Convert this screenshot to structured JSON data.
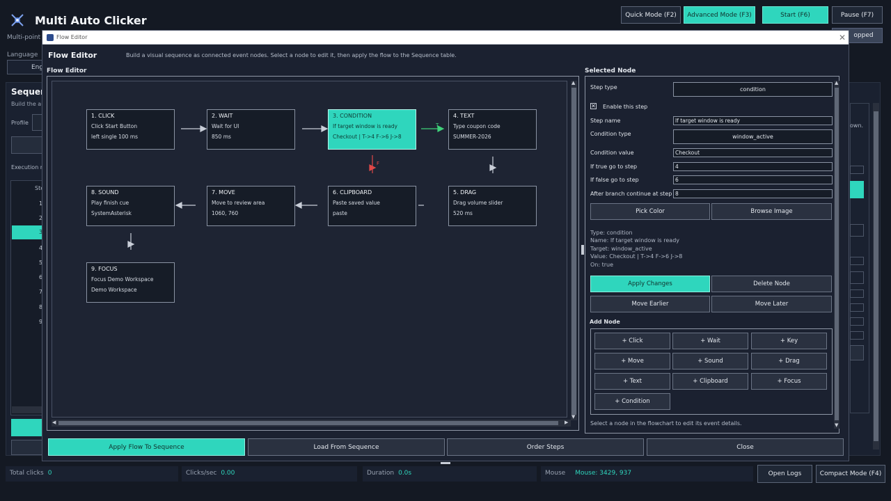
{
  "app": {
    "title": "Multi Auto Clicker",
    "subtitle": "Multi-point a",
    "language_label": "Language",
    "language_value": "Eng",
    "sequence_title": "Sequen",
    "sequence_subtitle": "Build the au",
    "profile_label": "Profile",
    "execution_label": "Execution m",
    "table_header": "Ste",
    "row_numbers": [
      "1",
      "2",
      "3",
      "4",
      "5",
      "6",
      "7",
      "8",
      "9"
    ],
    "stopped_label": "opped",
    "hint_fragment": "own.",
    "accent_color": "#2fd6bd"
  },
  "top_buttons": {
    "quick_mode": "Quick Mode (F2)",
    "advanced_mode": "Advanced Mode (F3)",
    "start": "Start (F6)",
    "pause": "Pause (F7)"
  },
  "status_bar": {
    "total_clicks_label": "Total clicks",
    "total_clicks_value": "0",
    "clicks_sec_label": "Clicks/sec",
    "clicks_sec_value": "0.00",
    "duration_label": "Duration",
    "duration_value": "0.0s",
    "mouse_label": "Mouse",
    "mouse_value": "Mouse: 3429, 937",
    "open_logs": "Open Logs",
    "compact_mode": "Compact Mode (F4)"
  },
  "dialog": {
    "window_title": "Flow Editor",
    "heading": "Flow Editor",
    "description": "Build a visual sequence as connected event nodes. Select a node to edit it, then apply the flow to the Sequence table.",
    "flow_section_label": "Flow Editor",
    "selected_section_label": "Selected Node"
  },
  "nodes": [
    {
      "title": "1. CLICK",
      "line1": "Click Start Button",
      "line2": "left single 100 ms"
    },
    {
      "title": "2. WAIT",
      "line1": "Wait for UI",
      "line2": "850 ms"
    },
    {
      "title": "3. CONDITION",
      "line1": "If target window is ready",
      "line2": "Checkout | T->4 F->6 J->8"
    },
    {
      "title": "4. TEXT",
      "line1": "Type coupon code",
      "line2": "SUMMER-2026"
    },
    {
      "title": "5. DRAG",
      "line1": "Drag volume slider",
      "line2": "520 ms"
    },
    {
      "title": "6. CLIPBOARD",
      "line1": "Paste saved value",
      "line2": "paste"
    },
    {
      "title": "7. MOVE",
      "line1": "Move to review area",
      "line2": "1060, 760"
    },
    {
      "title": "8. SOUND",
      "line1": "Play finish cue",
      "line2": "SystemAsterisk"
    },
    {
      "title": "9. FOCUS",
      "line1": "Focus Demo Workspace",
      "line2": "Demo Workspace"
    }
  ],
  "branch_labels": {
    "true": "T",
    "false": "F"
  },
  "selected_node": {
    "step_type_label": "Step type",
    "step_type_value": "condition",
    "enable_label": "Enable this step",
    "step_name_label": "Step name",
    "step_name_value": "If target window is ready",
    "condition_type_label": "Condition type",
    "condition_type_value": "window_active",
    "condition_value_label": "Condition value",
    "condition_value_value": "Checkout",
    "if_true_label": "If true go to step",
    "if_true_value": "4",
    "if_false_label": "If false go to step",
    "if_false_value": "6",
    "after_branch_label": "After branch continue at step",
    "after_branch_value": "8",
    "pick_color": "Pick Color",
    "browse_image": "Browse Image",
    "info_text": "Type: condition\nName: If target window is ready\nTarget: window_active\nValue: Checkout | T->4 F->6 J->8\nOn: true",
    "apply_changes": "Apply Changes",
    "delete_node": "Delete Node",
    "move_earlier": "Move Earlier",
    "move_later": "Move Later",
    "add_node_label": "Add Node",
    "add_buttons": [
      "+ Click",
      "+ Wait",
      "+ Key",
      "+ Move",
      "+ Sound",
      "+ Drag",
      "+ Text",
      "+ Clipboard",
      "+ Focus",
      "+ Condition"
    ],
    "hint": "Select a node in the flowchart to edit its event details."
  },
  "bottom_buttons": {
    "apply_flow": "Apply Flow To Sequence",
    "load_from": "Load From Sequence",
    "order_steps": "Order Steps",
    "close": "Close"
  }
}
